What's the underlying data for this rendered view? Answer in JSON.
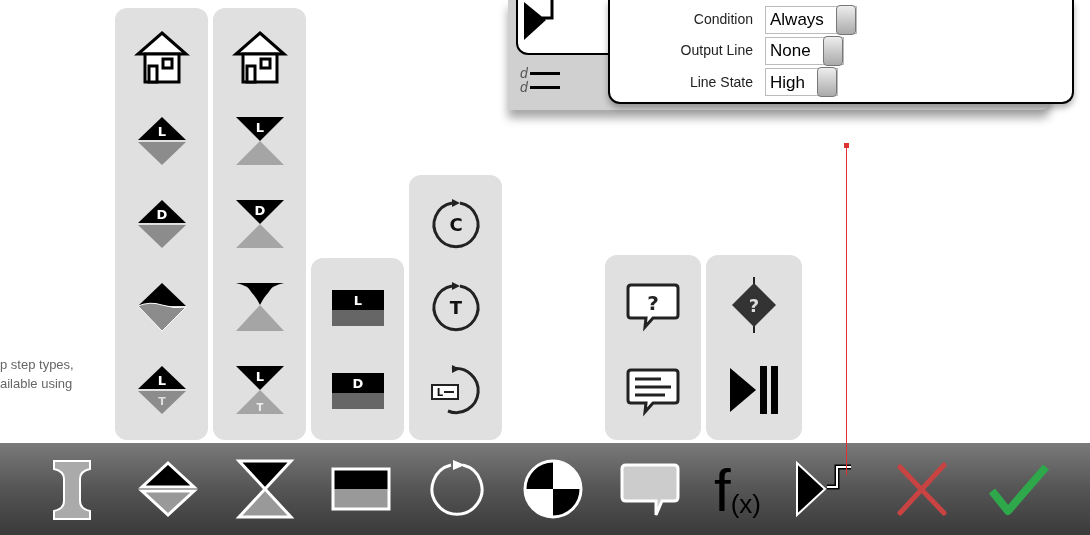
{
  "caption": {
    "lines": [
      "p step types,",
      "ailable  using"
    ]
  },
  "palette_columns": [
    {
      "items": [
        {
          "kind": "home"
        },
        {
          "kind": "diamond",
          "letter": "L"
        },
        {
          "kind": "diamond",
          "letter": "D"
        },
        {
          "kind": "wave-diamond"
        },
        {
          "kind": "diamond",
          "letter": "L",
          "lower_letter": "T"
        }
      ]
    },
    {
      "items": [
        {
          "kind": "home"
        },
        {
          "kind": "hourglass",
          "letter": "L"
        },
        {
          "kind": "hourglass",
          "letter": "D"
        },
        {
          "kind": "wave-hourglass"
        },
        {
          "kind": "hourglass",
          "letter": "L",
          "lower_letter": "T"
        }
      ]
    },
    {
      "items": [
        {
          "kind": "bar",
          "letter": "L"
        },
        {
          "kind": "bar",
          "letter": "D"
        }
      ]
    },
    {
      "items": [
        {
          "kind": "loop",
          "letter": "C"
        },
        {
          "kind": "loop",
          "letter": "T"
        },
        {
          "kind": "loop-line",
          "letter": "L"
        }
      ]
    },
    {
      "items": [
        {
          "kind": "question-bubble",
          "letter": "?"
        },
        {
          "kind": "text-bubble"
        }
      ]
    },
    {
      "items": [
        {
          "kind": "decision",
          "letter": "?"
        },
        {
          "kind": "play-pause"
        }
      ]
    }
  ],
  "dialog": {
    "side_marks": [
      "d",
      "d"
    ],
    "fields": [
      {
        "label": "Condition",
        "value": "Always"
      },
      {
        "label": "Output Line",
        "value": "None"
      },
      {
        "label": "Line State",
        "value": "High"
      }
    ]
  },
  "toolbar": [
    {
      "kind": "ibeam"
    },
    {
      "kind": "diamond"
    },
    {
      "kind": "hourglass"
    },
    {
      "kind": "bar"
    },
    {
      "kind": "loop"
    },
    {
      "kind": "quarters"
    },
    {
      "kind": "bubble"
    },
    {
      "kind": "fx",
      "text": "f",
      "sub": "(x)"
    },
    {
      "kind": "step"
    },
    {
      "kind": "close"
    },
    {
      "kind": "check"
    }
  ]
}
